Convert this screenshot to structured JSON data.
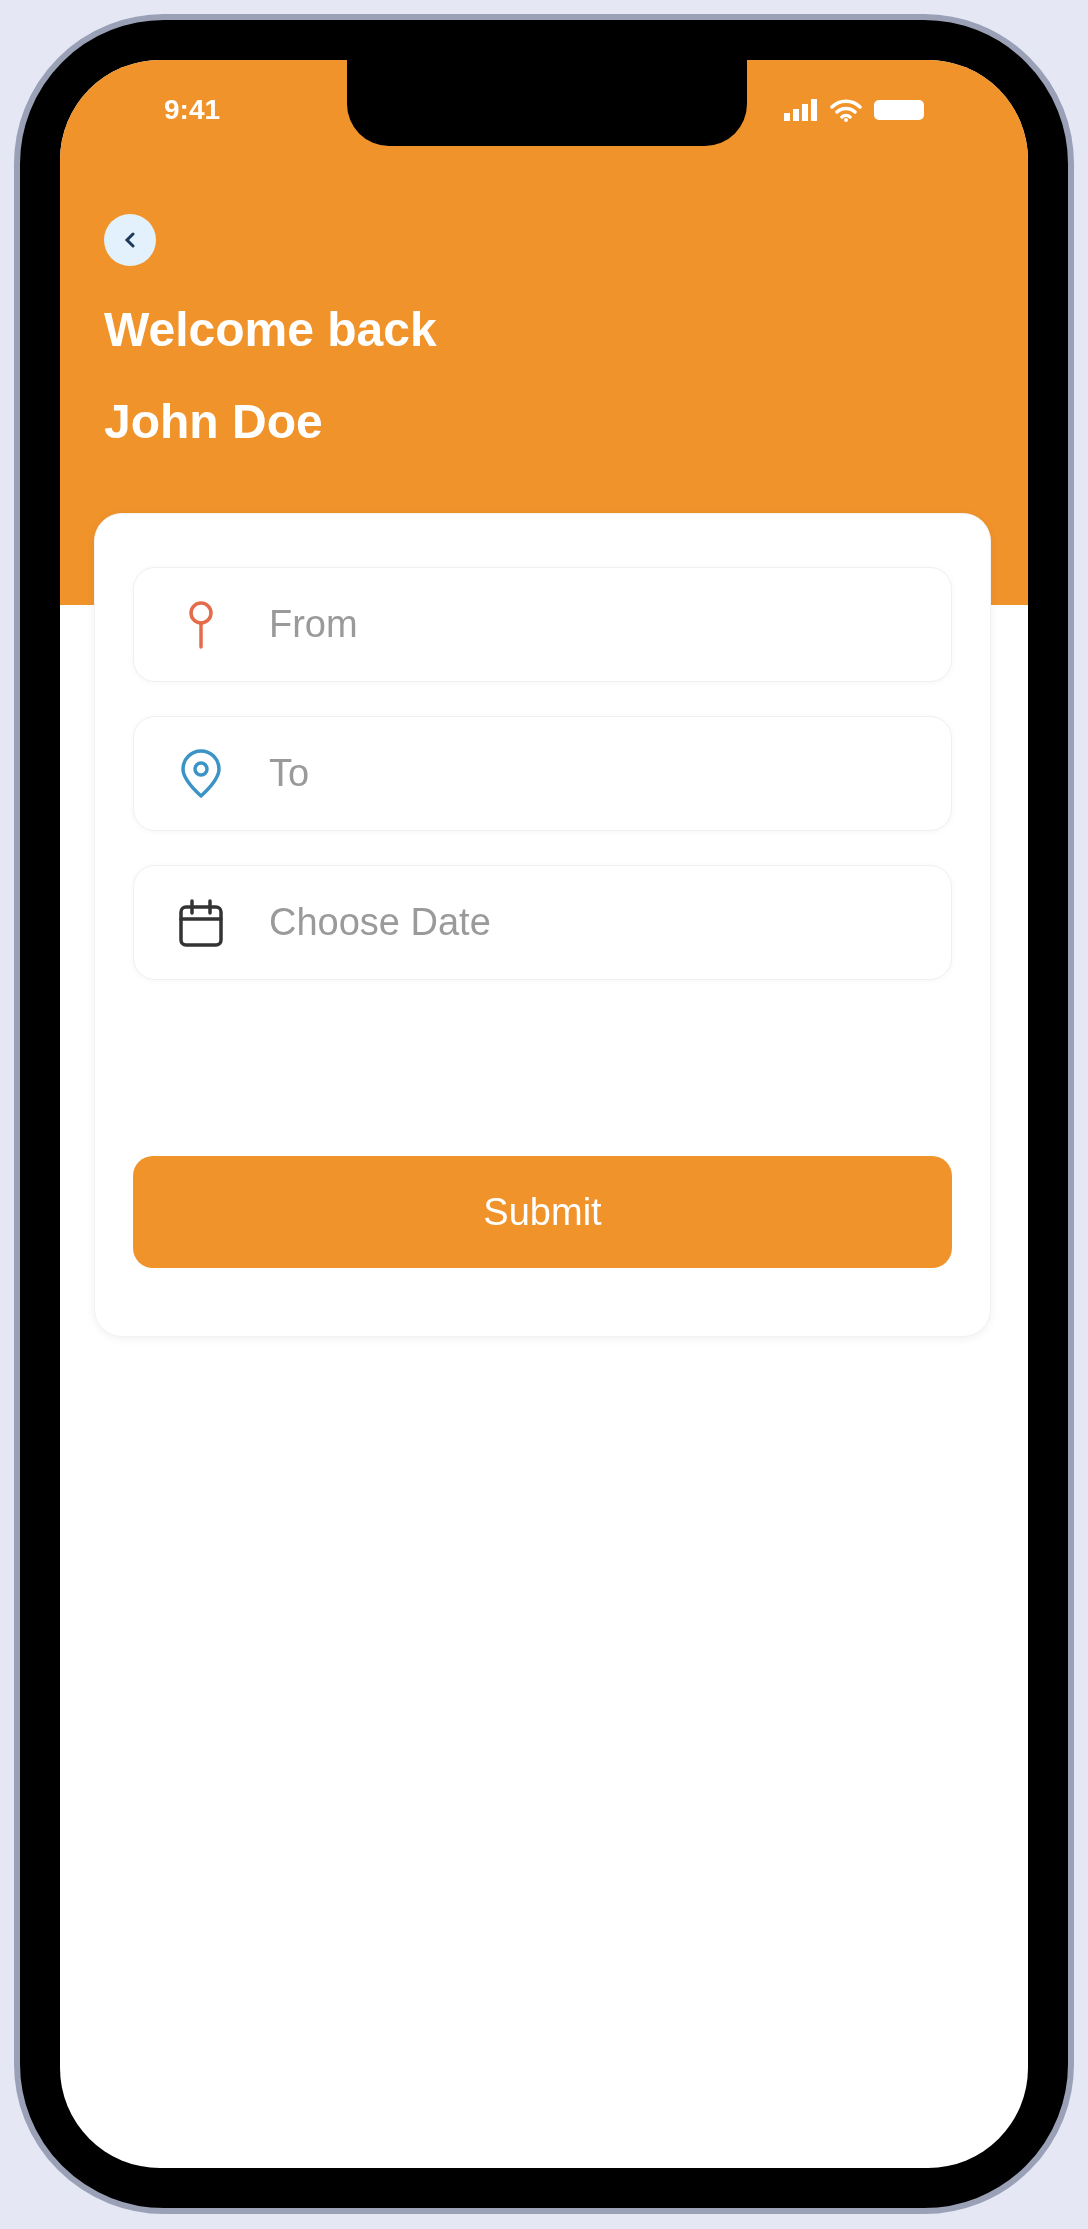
{
  "status_bar": {
    "time": "9:41"
  },
  "header": {
    "greeting": "Welcome back",
    "name": "John Doe"
  },
  "form": {
    "fields": [
      {
        "kind": "pin",
        "placeholder": "From"
      },
      {
        "kind": "location",
        "placeholder": "To"
      },
      {
        "kind": "calendar",
        "placeholder": "Choose Date"
      }
    ],
    "submit": "Submit"
  }
}
